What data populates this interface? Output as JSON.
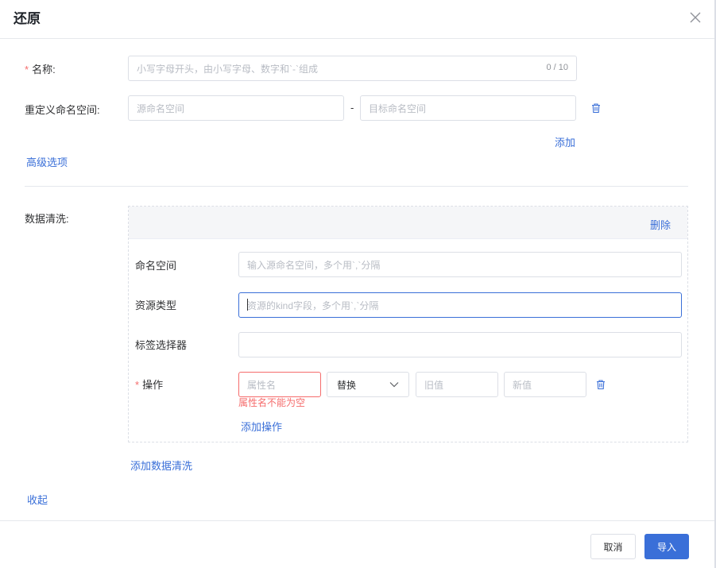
{
  "dialog": {
    "title": "还原"
  },
  "form": {
    "name": {
      "label": "名称:",
      "required_mark": "*",
      "placeholder": "小写字母开头，由小写字母、数字和`-`组成",
      "counter": "0 / 10"
    },
    "namespace_mapping": {
      "label": "重定义命名空间:",
      "source_placeholder": "源命名空间",
      "separator": "-",
      "target_placeholder": "目标命名空间",
      "add_label": "添加"
    },
    "advanced_label": "高级选项",
    "data_cleaning": {
      "label": "数据清洗:",
      "delete_label": "删除",
      "namespace": {
        "label": "命名空间",
        "placeholder": "输入源命名空间，多个用`,`分隔"
      },
      "resource_type": {
        "label": "资源类型",
        "placeholder": "资源的kind字段，多个用`,`分隔"
      },
      "label_selector": {
        "label": "标签选择器",
        "placeholder": ""
      },
      "operation": {
        "label": "操作",
        "required_mark": "*",
        "attr_placeholder": "属性名",
        "op_value": "替换",
        "old_placeholder": "旧值",
        "new_placeholder": "新值",
        "error": "属性名不能为空",
        "add_label": "添加操作"
      },
      "add_label": "添加数据清洗"
    },
    "collapse_label": "收起"
  },
  "footer": {
    "cancel_label": "取消",
    "import_label": "导入"
  },
  "colors": {
    "primary": "#3a6fd8",
    "danger": "#f56c6c",
    "border": "#dcdfe6"
  }
}
